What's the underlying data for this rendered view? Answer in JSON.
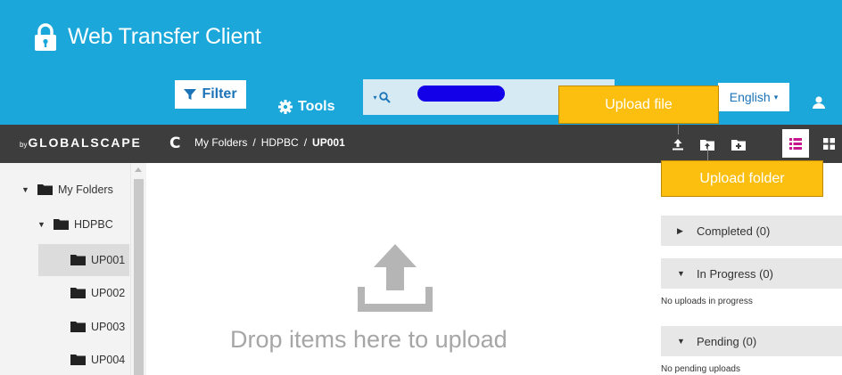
{
  "app": {
    "title": "Web Transfer Client"
  },
  "colors": {
    "header": "#1ba7d9",
    "toolbar": "#3d3d3d",
    "accent": "#1b74b8",
    "callout": "#fdbf0f",
    "redaction": "#1400e8"
  },
  "header": {
    "filter_label": "Filter",
    "tools_label": "Tools",
    "search": {
      "value": "",
      "placeholder": ""
    },
    "language_label": "English"
  },
  "toolbar": {
    "brand_prefix": "by",
    "brand": "GLOBALSCAPE",
    "breadcrumb": [
      "My Folders",
      "HDPBC",
      "UP001"
    ]
  },
  "tree": {
    "items": [
      {
        "label": "My Folders",
        "expanded": true
      },
      {
        "label": "HDPBC",
        "expanded": true
      },
      {
        "label": "UP001",
        "selected": true
      },
      {
        "label": "UP002"
      },
      {
        "label": "UP003"
      },
      {
        "label": "UP004"
      }
    ]
  },
  "dropzone": {
    "text": "Drop items here to upload"
  },
  "transfers": {
    "completed_label": "Completed (0)",
    "in_progress_label": "In Progress (0)",
    "in_progress_note": "No uploads in progress",
    "pending_label": "Pending (0)",
    "pending_note": "No pending uploads"
  },
  "callouts": {
    "upload_file": "Upload file",
    "upload_folder": "Upload folder"
  },
  "icons": [
    "lock-icon",
    "filter-icon",
    "gear-icon",
    "search-icon",
    "user-icon",
    "refresh-icon",
    "upload-icon",
    "upload-folder-icon",
    "new-folder-icon",
    "list-view-icon",
    "grid-view-icon",
    "folder-icon"
  ]
}
